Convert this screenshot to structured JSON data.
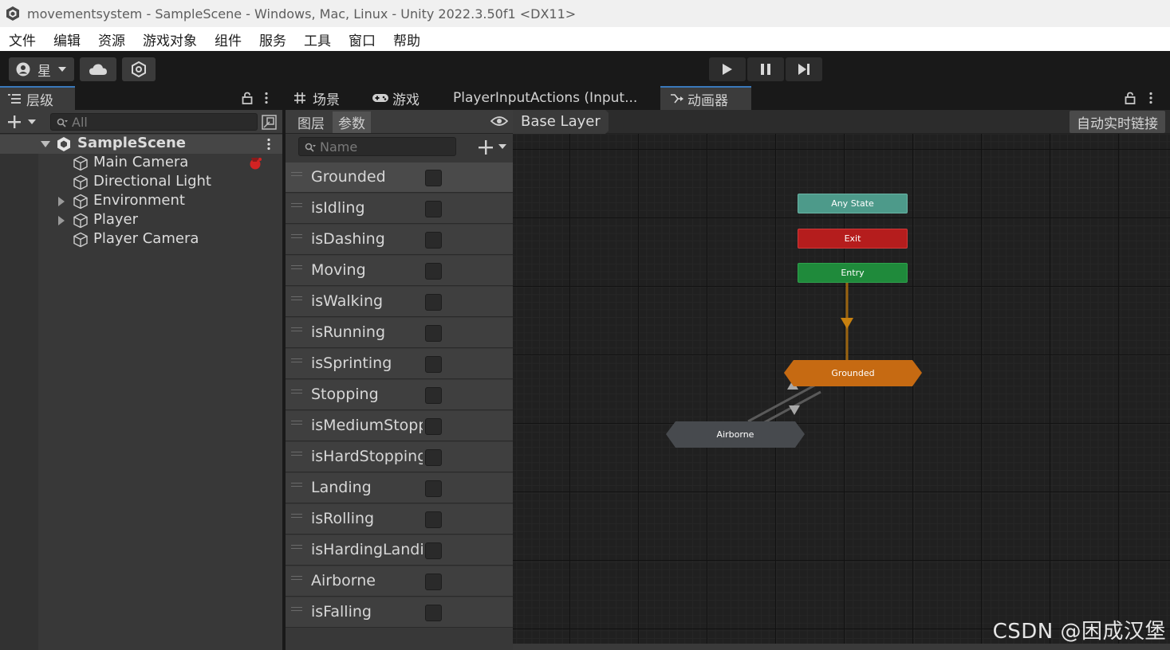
{
  "window": {
    "title": "movementsystem - SampleScene - Windows, Mac, Linux - Unity 2022.3.50f1 <DX11>"
  },
  "menu": [
    "文件",
    "编辑",
    "资源",
    "游戏对象",
    "组件",
    "服务",
    "工具",
    "窗口",
    "帮助"
  ],
  "toolbar": {
    "account_label": "星"
  },
  "hierarchy": {
    "tab_label": "层级",
    "search_placeholder": "All",
    "scene": "SampleScene",
    "items": [
      {
        "label": "Main Camera",
        "expandable": false
      },
      {
        "label": "Directional Light",
        "expandable": false
      },
      {
        "label": "Environment",
        "expandable": true
      },
      {
        "label": "Player",
        "expandable": true
      },
      {
        "label": "Player Camera",
        "expandable": false
      }
    ]
  },
  "tabs": {
    "scene": "场景",
    "game": "游戏",
    "input_actions": "PlayerInputActions (Input...",
    "animator": "动画器"
  },
  "animator": {
    "layers_tab": "图层",
    "params_tab": "参数",
    "name_placeholder": "Name",
    "breadcrumb": "Base Layer",
    "live_link": "自动实时链接",
    "parameters": [
      "Grounded",
      "isIdling",
      "isDashing",
      "Moving",
      "isWalking",
      "isRunning",
      "isSprinting",
      "Stopping",
      "isMediumStopping",
      "isHardStopping",
      "Landing",
      "isRolling",
      "isHardingLanding",
      "Airborne",
      "isFalling"
    ],
    "states": {
      "any_state": "Any State",
      "exit": "Exit",
      "entry": "Entry",
      "grounded": "Grounded",
      "airborne": "Airborne"
    },
    "colors": {
      "any_state": "#4d9a8a",
      "exit": "#b51d1d",
      "entry": "#1f8a3b",
      "default_state": "#c66a12",
      "state": "#474a4e"
    }
  },
  "watermark": "CSDN @困成汉堡"
}
